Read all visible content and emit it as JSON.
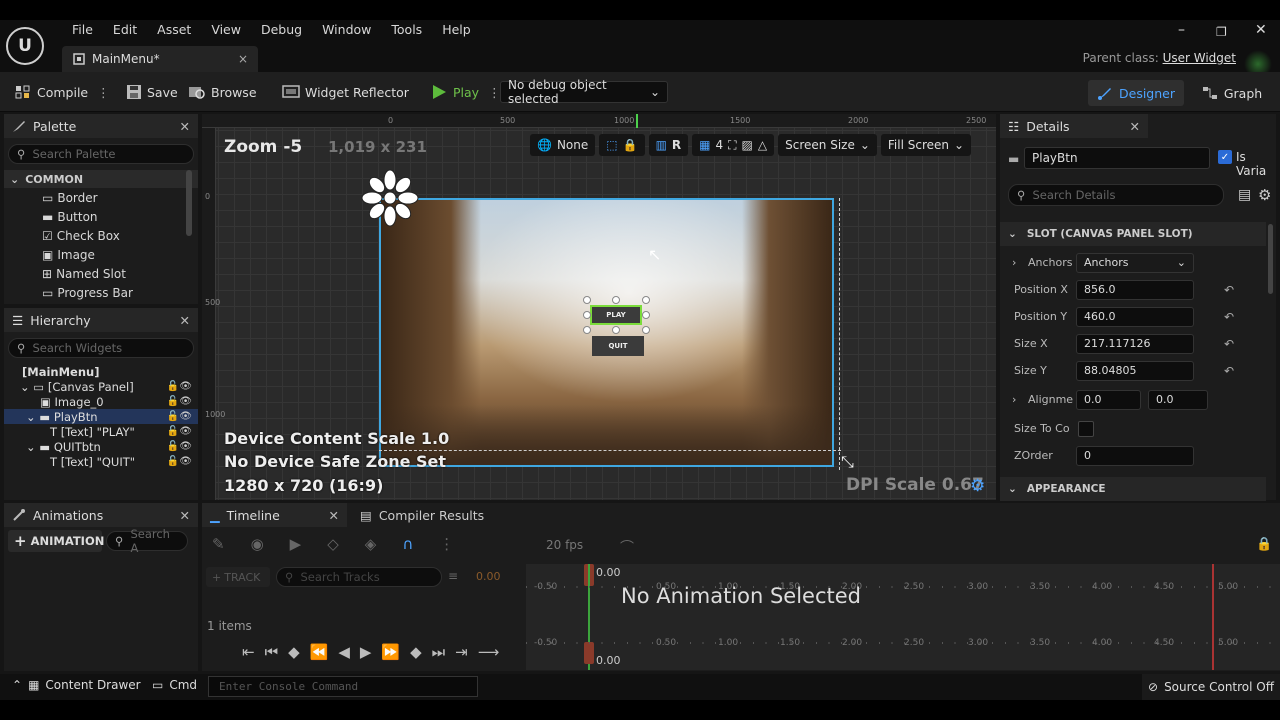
{
  "menu": [
    "File",
    "Edit",
    "Asset",
    "View",
    "Debug",
    "Window",
    "Tools",
    "Help"
  ],
  "logo_text": "U",
  "doc_tab": {
    "label": "MainMenu*",
    "close": "×"
  },
  "window_controls": {
    "min": "–",
    "max": "❐",
    "close": "✕"
  },
  "parent_class": {
    "label": "Parent class:",
    "value": "User Widget"
  },
  "toolbar": {
    "compile": "Compile",
    "save": "Save",
    "browse": "Browse",
    "widget_reflector": "Widget Reflector",
    "play": "Play",
    "debug_select": "No debug object selected",
    "designer": "Designer",
    "graph": "Graph"
  },
  "palette": {
    "title": "Palette",
    "search_placeholder": "Search Palette",
    "category": "COMMON",
    "items": [
      "Border",
      "Button",
      "Check Box",
      "Image",
      "Named Slot",
      "Progress Bar"
    ]
  },
  "hierarchy": {
    "title": "Hierarchy",
    "search_placeholder": "Search Widgets",
    "rows": [
      "[MainMenu]",
      "[Canvas Panel]",
      "Image_0",
      "PlayBtn",
      "[Text] \"PLAY\"",
      "QUITbtn",
      "[Text] \"QUIT\""
    ]
  },
  "viewport": {
    "zoom": "Zoom -5",
    "resolution": "1,019 x 231",
    "none": "None",
    "r": "R",
    "grid": "4",
    "screen_size": "Screen Size",
    "fill_screen": "Fill Screen",
    "ruler_h": [
      "0",
      "500",
      "1000",
      "1500",
      "2000",
      "2500"
    ],
    "ruler_v": [
      "0",
      "500",
      "1000"
    ],
    "play_button": "PLAY",
    "quit_button": "QUIT",
    "device_scale": "Device Content Scale 1.0",
    "safe_zone": "No Device Safe Zone Set",
    "aspect": "1280 x 720 (16:9)",
    "dpi": "DPI Scale 0.67"
  },
  "details": {
    "title": "Details",
    "name_value": "PlayBtn",
    "is_variable": "Is Varia",
    "search_placeholder": "Search Details",
    "slot_section": "SLOT (CANVAS PANEL SLOT)",
    "anchors_label": "Anchors",
    "anchors_value": "Anchors",
    "pos_x_label": "Position X",
    "pos_x": "856.0",
    "pos_y_label": "Position Y",
    "pos_y": "460.0",
    "size_x_label": "Size X",
    "size_x": "217.117126",
    "size_y_label": "Size Y",
    "size_y": "88.04805",
    "align_label": "Alignme",
    "align_x": "0.0",
    "align_y": "0.0",
    "size_to_content": "Size To Co",
    "zorder_label": "ZOrder",
    "zorder": "0",
    "appearance": "APPEARANCE"
  },
  "animations": {
    "title": "Animations",
    "add": "ANIMATION",
    "search_placeholder": "Search A"
  },
  "timeline": {
    "tab": "Timeline",
    "compiler": "Compiler Results",
    "fps": "20 fps",
    "track": "TRACK",
    "search_placeholder": "Search Tracks",
    "time": "0.00",
    "items": "1 items",
    "no_anim": "No Animation Selected",
    "ticks": [
      "-0.50",
      "0.50",
      "1.00",
      "1.50",
      "2.00",
      "2.50",
      "3.00",
      "3.50",
      "4.00",
      "4.50",
      "5.00"
    ]
  },
  "status": {
    "content_drawer": "Content Drawer",
    "cmd": "Cmd",
    "console_placeholder": "Enter Console Command",
    "source_control": "Source Control Off"
  }
}
